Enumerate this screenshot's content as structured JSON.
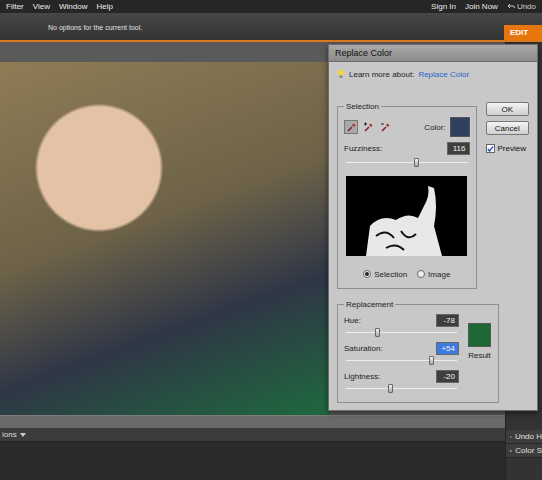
{
  "menu": {
    "items": [
      "Filter",
      "View",
      "Window",
      "Help"
    ],
    "account": [
      "Sign In",
      "Join Now"
    ],
    "undo": "Undo"
  },
  "options_bar": {
    "text": "No options for the current tool.",
    "mode_tabs": [
      {
        "label": "EDIT",
        "selected": true
      }
    ]
  },
  "dialog": {
    "title": "Replace Color",
    "help": {
      "prefix": "Learn more about:",
      "link": "Replace Color"
    },
    "selection": {
      "legend": "Selection",
      "eyedroppers": [
        {
          "kind": "sample",
          "selected": true
        },
        {
          "kind": "add",
          "selected": false
        },
        {
          "kind": "subtract",
          "selected": false
        }
      ],
      "color_label": "Color:",
      "color": "#2f3f5e",
      "fuzziness": {
        "label": "Fuzziness:",
        "value": "116",
        "level": 0.58
      },
      "view_options": [
        {
          "label": "Selection",
          "selected": true
        },
        {
          "label": "Image",
          "selected": false
        }
      ]
    },
    "buttons": [
      "OK",
      "Cancel"
    ],
    "preview": {
      "label": "Preview",
      "checked": true
    },
    "replacement": {
      "legend": "Replacement",
      "sliders": [
        {
          "label": "Hue:",
          "value": "-78",
          "level": 0.28,
          "selected": false
        },
        {
          "label": "Saturation:",
          "value": "+54",
          "level": 0.77,
          "selected": true
        },
        {
          "label": "Lightness:",
          "value": "-20",
          "level": 0.4,
          "selected": false
        }
      ],
      "result_label": "Result",
      "result_color": "#1d6834"
    }
  },
  "panels": [
    {
      "label": "Undo H",
      "expanded": false
    },
    {
      "label": "Color S",
      "expanded": false
    }
  ],
  "bottom_panel": {
    "label": "ions",
    "expanded": true
  }
}
